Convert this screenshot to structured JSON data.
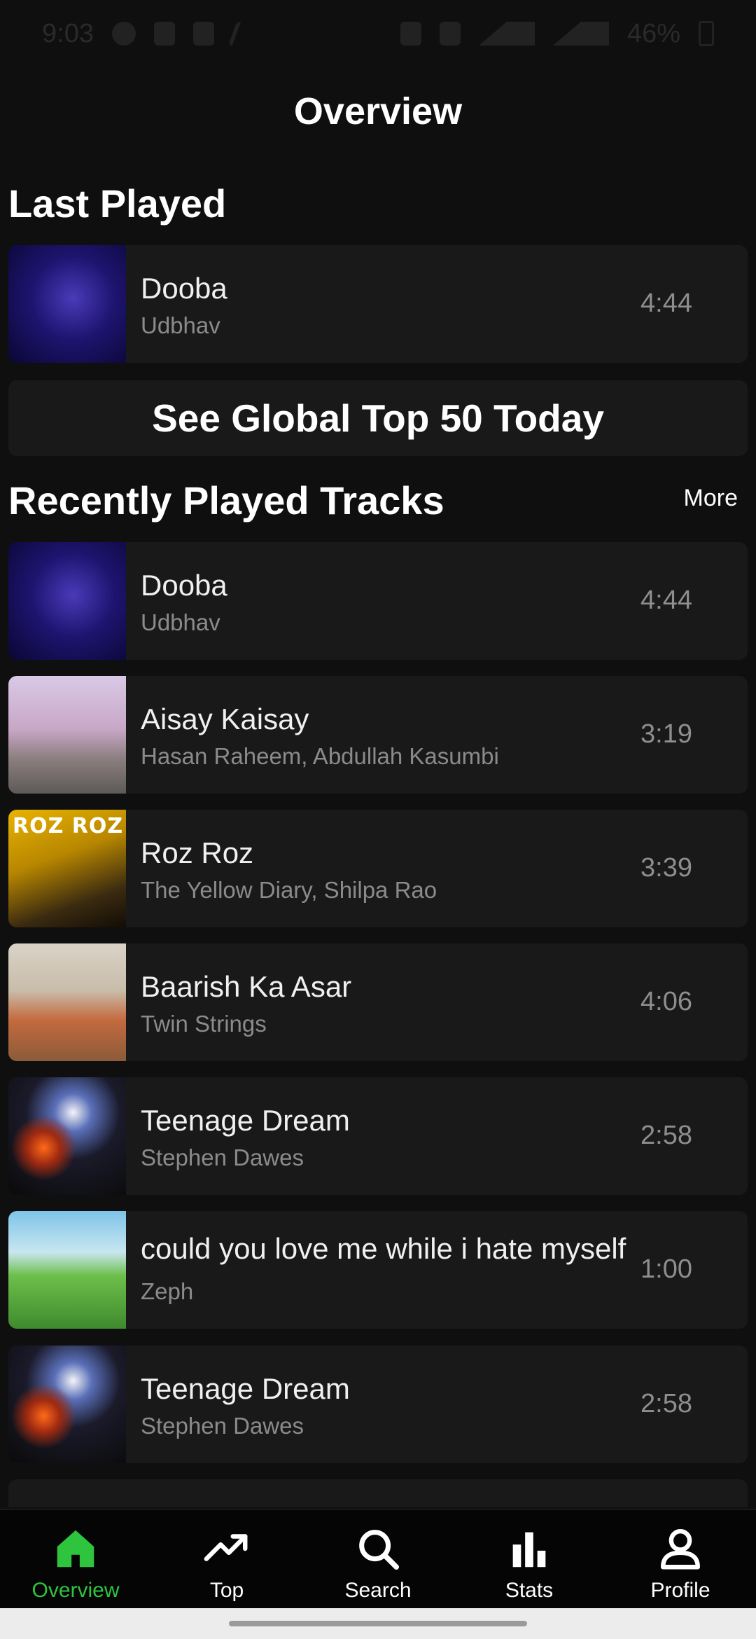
{
  "status_bar": {
    "time": "9:03",
    "battery": "46%"
  },
  "page_title": "Overview",
  "last_played": {
    "heading": "Last Played",
    "track": {
      "title": "Dooba",
      "artist": "Udbhav",
      "duration": "4:44"
    }
  },
  "cta_label": "See Global Top 50 Today",
  "recent": {
    "heading": "Recently Played Tracks",
    "more_label": "More",
    "tracks": [
      {
        "title": "Dooba",
        "artist": "Udbhav",
        "duration": "4:44"
      },
      {
        "title": "Aisay Kaisay",
        "artist": "Hasan Raheem, Abdullah Kasumbi",
        "duration": "3:19"
      },
      {
        "title": "Roz Roz",
        "artist": "The Yellow Diary, Shilpa Rao",
        "duration": "3:39",
        "art_text": "ROZ ROZ"
      },
      {
        "title": "Baarish Ka Asar",
        "artist": "Twin Strings",
        "duration": "4:06"
      },
      {
        "title": "Teenage Dream",
        "artist": "Stephen Dawes",
        "duration": "2:58"
      },
      {
        "title": "could you love me while i hate myself",
        "artist": "Zeph",
        "duration": "1:00"
      },
      {
        "title": "Teenage Dream",
        "artist": "Stephen Dawes",
        "duration": "2:58"
      }
    ]
  },
  "nav": {
    "items": [
      {
        "label": "Overview",
        "icon": "home-icon",
        "active": true
      },
      {
        "label": "Top",
        "icon": "trending-icon"
      },
      {
        "label": "Search",
        "icon": "search-icon"
      },
      {
        "label": "Stats",
        "icon": "bar-chart-icon"
      },
      {
        "label": "Profile",
        "icon": "user-icon"
      }
    ],
    "active_color": "#2ec43d"
  }
}
